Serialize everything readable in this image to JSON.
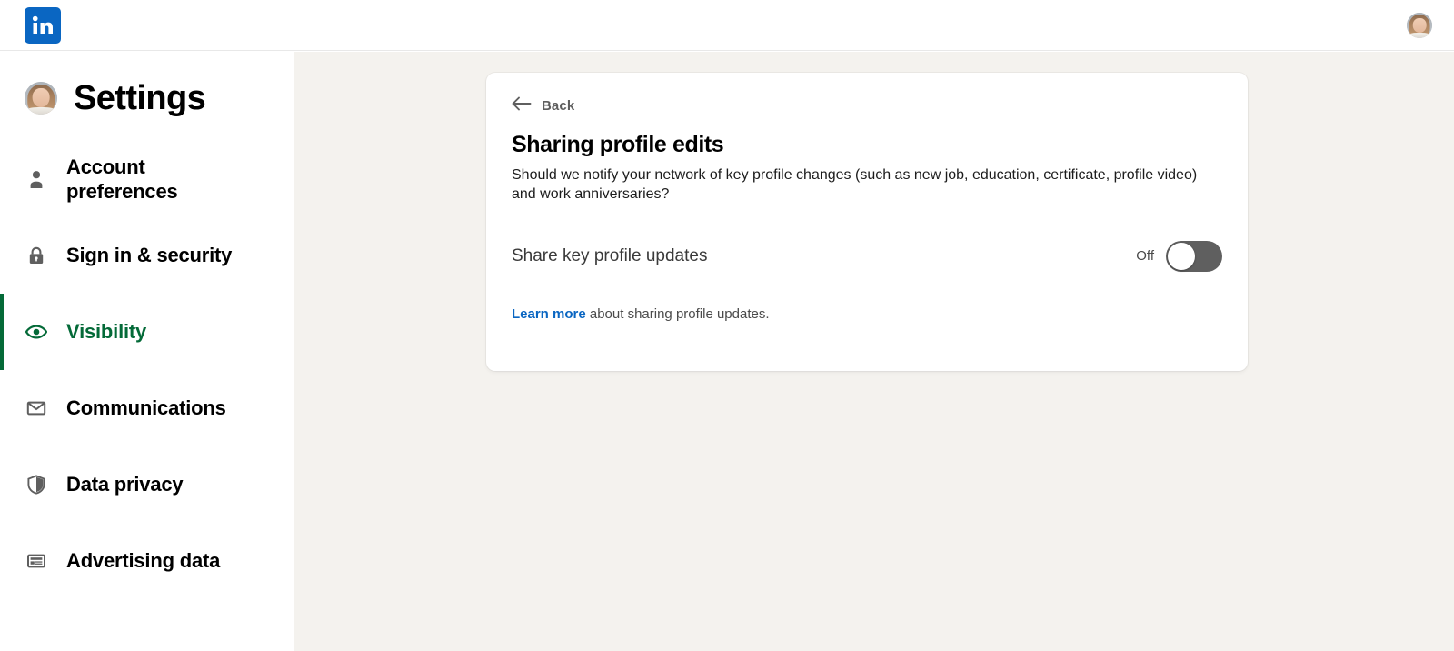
{
  "topbar": {
    "logo_name": "linkedin-logo",
    "logo_text": "in",
    "avatar_name": "user-avatar"
  },
  "sidebar": {
    "title": "Settings",
    "avatar_name": "settings-profile-avatar",
    "items": [
      {
        "label": "Account preferences",
        "icon": "person-icon",
        "active": false
      },
      {
        "label": "Sign in & security",
        "icon": "lock-icon",
        "active": false
      },
      {
        "label": "Visibility",
        "icon": "eye-icon",
        "active": true
      },
      {
        "label": "Communications",
        "icon": "envelope-icon",
        "active": false
      },
      {
        "label": "Data privacy",
        "icon": "shield-icon",
        "active": false
      },
      {
        "label": "Advertising data",
        "icon": "ad-card-icon",
        "active": false
      }
    ]
  },
  "card": {
    "back_label": "Back",
    "back_icon": "arrow-left-icon",
    "title": "Sharing profile edits",
    "description": "Should we notify your network of key profile changes (such as new job, education, certificate, profile video) and work anniversaries?",
    "setting_label": "Share key profile updates",
    "toggle_state": "Off",
    "toggle_on": false,
    "learn_more_link": "Learn more",
    "learn_more_rest": " about sharing profile updates."
  },
  "colors": {
    "accent_green": "#046a38",
    "link_blue": "#0a66c2",
    "brand_blue": "#0a66c2",
    "page_bg": "#f4f2ee"
  }
}
